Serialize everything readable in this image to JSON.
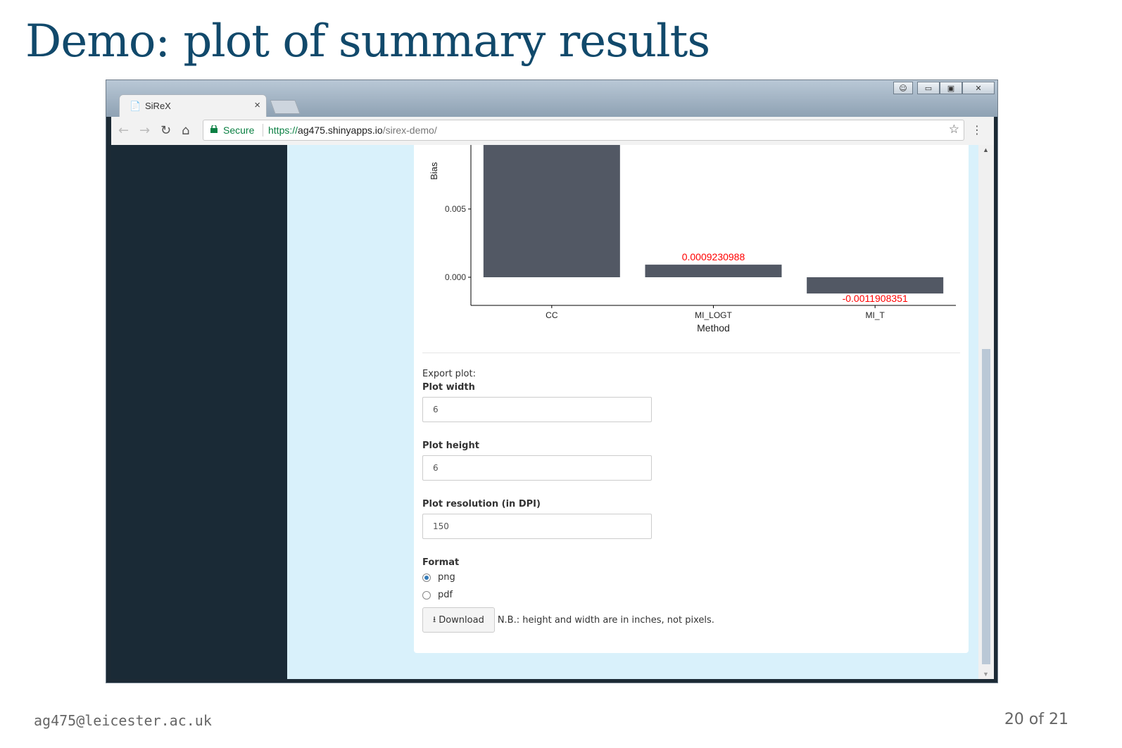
{
  "slide": {
    "title": "Demo: plot of summary results",
    "footer_email": "ag475@leicester.ac.uk",
    "page_number": "20 of 21"
  },
  "browser": {
    "tab_title": "SiReX",
    "secure_label": "Secure",
    "url_https": "https://",
    "url_host": "ag475.shinyapps.io",
    "url_path": "/sirex-demo/"
  },
  "colors": {
    "bar_fill": "#525864",
    "label_color": "#ff0000",
    "sidebar": "#1a2a36",
    "page_bg": "#d9f1fb",
    "title_color": "#11496b"
  },
  "chart_data": {
    "type": "bar",
    "categories": [
      "CC",
      "MI_LOGT",
      "MI_T"
    ],
    "values": [
      0.0105,
      0.0009230988,
      -0.0011908351
    ],
    "data_labels": [
      "",
      "0.0009230988",
      "-0.0011908351"
    ],
    "xlabel": "Method",
    "ylabel": "Bias",
    "yticks": [
      0.0,
      0.005
    ],
    "ytick_labels": [
      "0.000",
      "0.005"
    ],
    "ylim": [
      -0.002,
      0.0105
    ]
  },
  "form": {
    "export_label": "Export plot:",
    "width_label": "Plot width",
    "width_value": "6",
    "height_label": "Plot height",
    "height_value": "6",
    "resolution_label": "Plot resolution (in DPI)",
    "resolution_value": "150",
    "format_label": "Format",
    "format_options": [
      "png",
      "pdf"
    ],
    "format_selected": "png",
    "download_label": "Download",
    "note": "N.B.: height and width are in inches, not pixels."
  }
}
